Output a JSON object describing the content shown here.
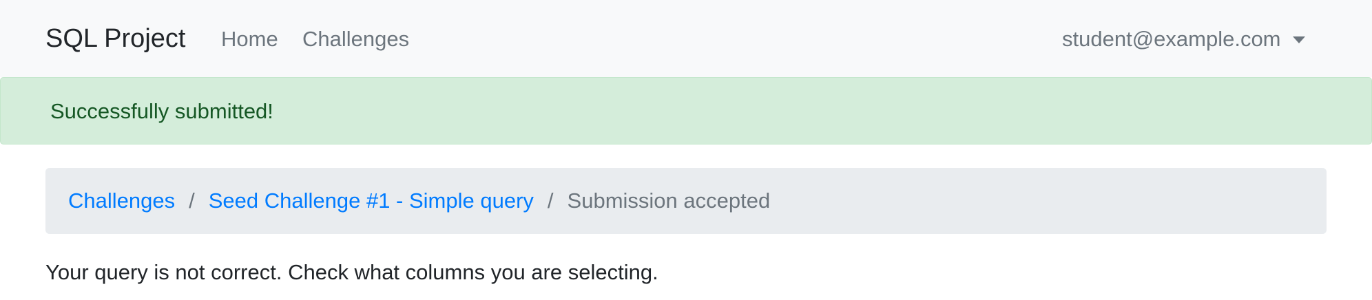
{
  "navbar": {
    "brand": "SQL Project",
    "links": [
      {
        "label": "Home"
      },
      {
        "label": "Challenges"
      }
    ],
    "user": {
      "email": "student@example.com",
      "icon": "chevron-down-icon"
    }
  },
  "alert": {
    "text": "Successfully submitted!",
    "type": "success",
    "color": "#155724",
    "background": "#d4edda"
  },
  "breadcrumb": {
    "items": [
      {
        "label": "Challenges"
      },
      {
        "label": "Seed Challenge #1 - Simple query"
      },
      {
        "label": "Submission accepted"
      }
    ],
    "separator": "/",
    "link_color": "#007bff"
  },
  "main": {
    "message": "Your query is not correct. Check what columns you are selecting."
  }
}
